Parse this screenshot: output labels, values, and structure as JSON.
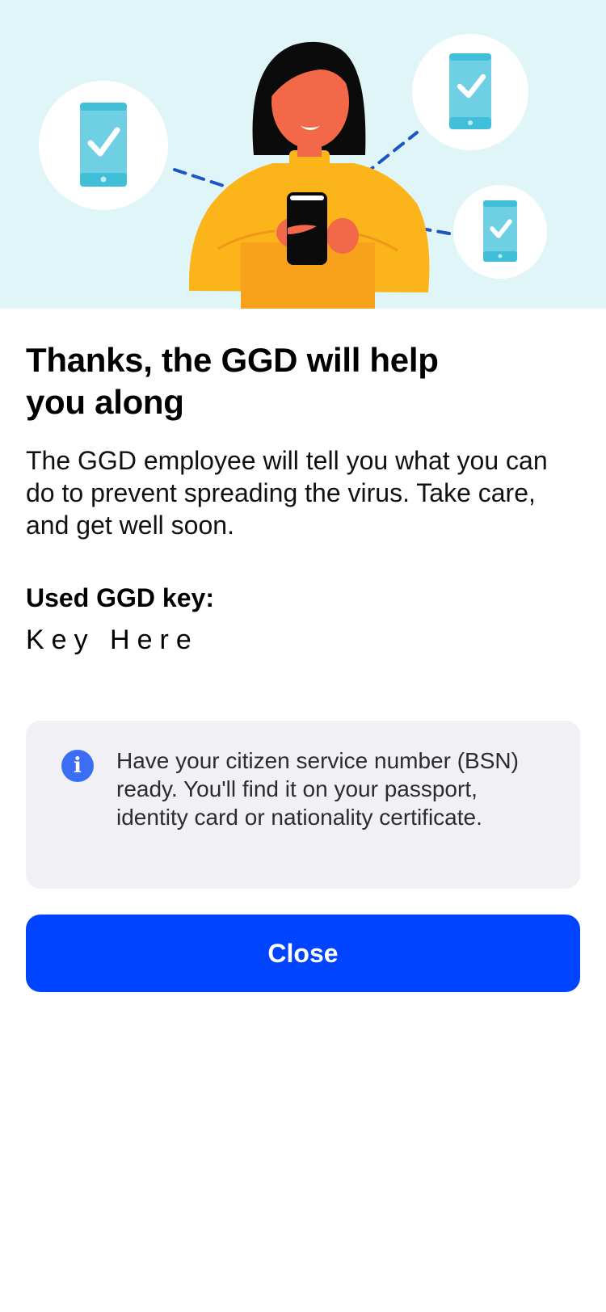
{
  "hero": {
    "illustration": "woman-with-phone-sharing-keys",
    "background_color": "#e0f5f8"
  },
  "main": {
    "title": "Thanks, the GGD will help you along",
    "body": "The GGD employee will tell you what you can do to prevent spreading the virus. Take care, and get well soon.",
    "key_label": "Used GGD key:",
    "key_value": "Key Here"
  },
  "info": {
    "icon": "info-icon",
    "text": "Have your citizen service number (BSN) ready. You'll find it on your passport, identity card or nationality certificate."
  },
  "actions": {
    "close_label": "Close",
    "accent_color": "#0044ff"
  }
}
